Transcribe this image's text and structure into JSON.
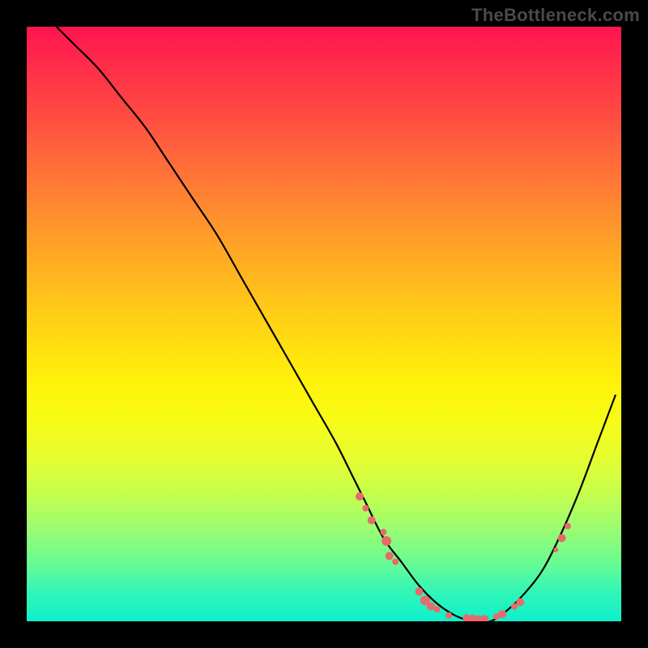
{
  "site": {
    "watermark": "TheBottleneck.com"
  },
  "chart_data": {
    "type": "line",
    "title": "",
    "xlabel": "",
    "ylabel": "",
    "xlim": [
      0,
      100
    ],
    "ylim": [
      0,
      100
    ],
    "grid": false,
    "background_gradient": {
      "top": "#ff1450",
      "bottom": "#0cf0cc"
    },
    "series": [
      {
        "name": "curve",
        "x": [
          5,
          8,
          12,
          16,
          20,
          24,
          28,
          32,
          36,
          40,
          44,
          48,
          52,
          55,
          57,
          60,
          63,
          66,
          69,
          72,
          75,
          78,
          81,
          84,
          87,
          90,
          93,
          96,
          99
        ],
        "y": [
          100,
          97,
          93,
          88,
          83,
          77,
          71,
          65,
          58,
          51,
          44,
          37,
          30,
          24,
          20,
          14,
          10,
          6,
          3,
          1,
          0,
          0,
          2,
          5,
          9,
          15,
          22,
          30,
          38
        ]
      }
    ],
    "highlight_points": [
      {
        "x": 56,
        "y": 21,
        "r": 5
      },
      {
        "x": 57,
        "y": 19,
        "r": 4
      },
      {
        "x": 58,
        "y": 17,
        "r": 5
      },
      {
        "x": 60,
        "y": 15,
        "r": 4
      },
      {
        "x": 60.5,
        "y": 13.5,
        "r": 6
      },
      {
        "x": 61,
        "y": 11,
        "r": 5
      },
      {
        "x": 62,
        "y": 10,
        "r": 4
      },
      {
        "x": 66,
        "y": 5,
        "r": 5
      },
      {
        "x": 67,
        "y": 3.5,
        "r": 6
      },
      {
        "x": 68,
        "y": 2.5,
        "r": 5
      },
      {
        "x": 69,
        "y": 2,
        "r": 4
      },
      {
        "x": 71,
        "y": 1,
        "r": 4
      },
      {
        "x": 74,
        "y": 0.5,
        "r": 5
      },
      {
        "x": 75,
        "y": 0.3,
        "r": 6
      },
      {
        "x": 76,
        "y": 0.3,
        "r": 5
      },
      {
        "x": 77,
        "y": 0.4,
        "r": 5
      },
      {
        "x": 79,
        "y": 0.8,
        "r": 4
      },
      {
        "x": 80,
        "y": 1.2,
        "r": 5
      },
      {
        "x": 82,
        "y": 2.5,
        "r": 4
      },
      {
        "x": 83,
        "y": 3.2,
        "r": 5
      },
      {
        "x": 89,
        "y": 12,
        "r": 3
      },
      {
        "x": 90,
        "y": 14,
        "r": 5
      },
      {
        "x": 91,
        "y": 16,
        "r": 4
      }
    ]
  }
}
